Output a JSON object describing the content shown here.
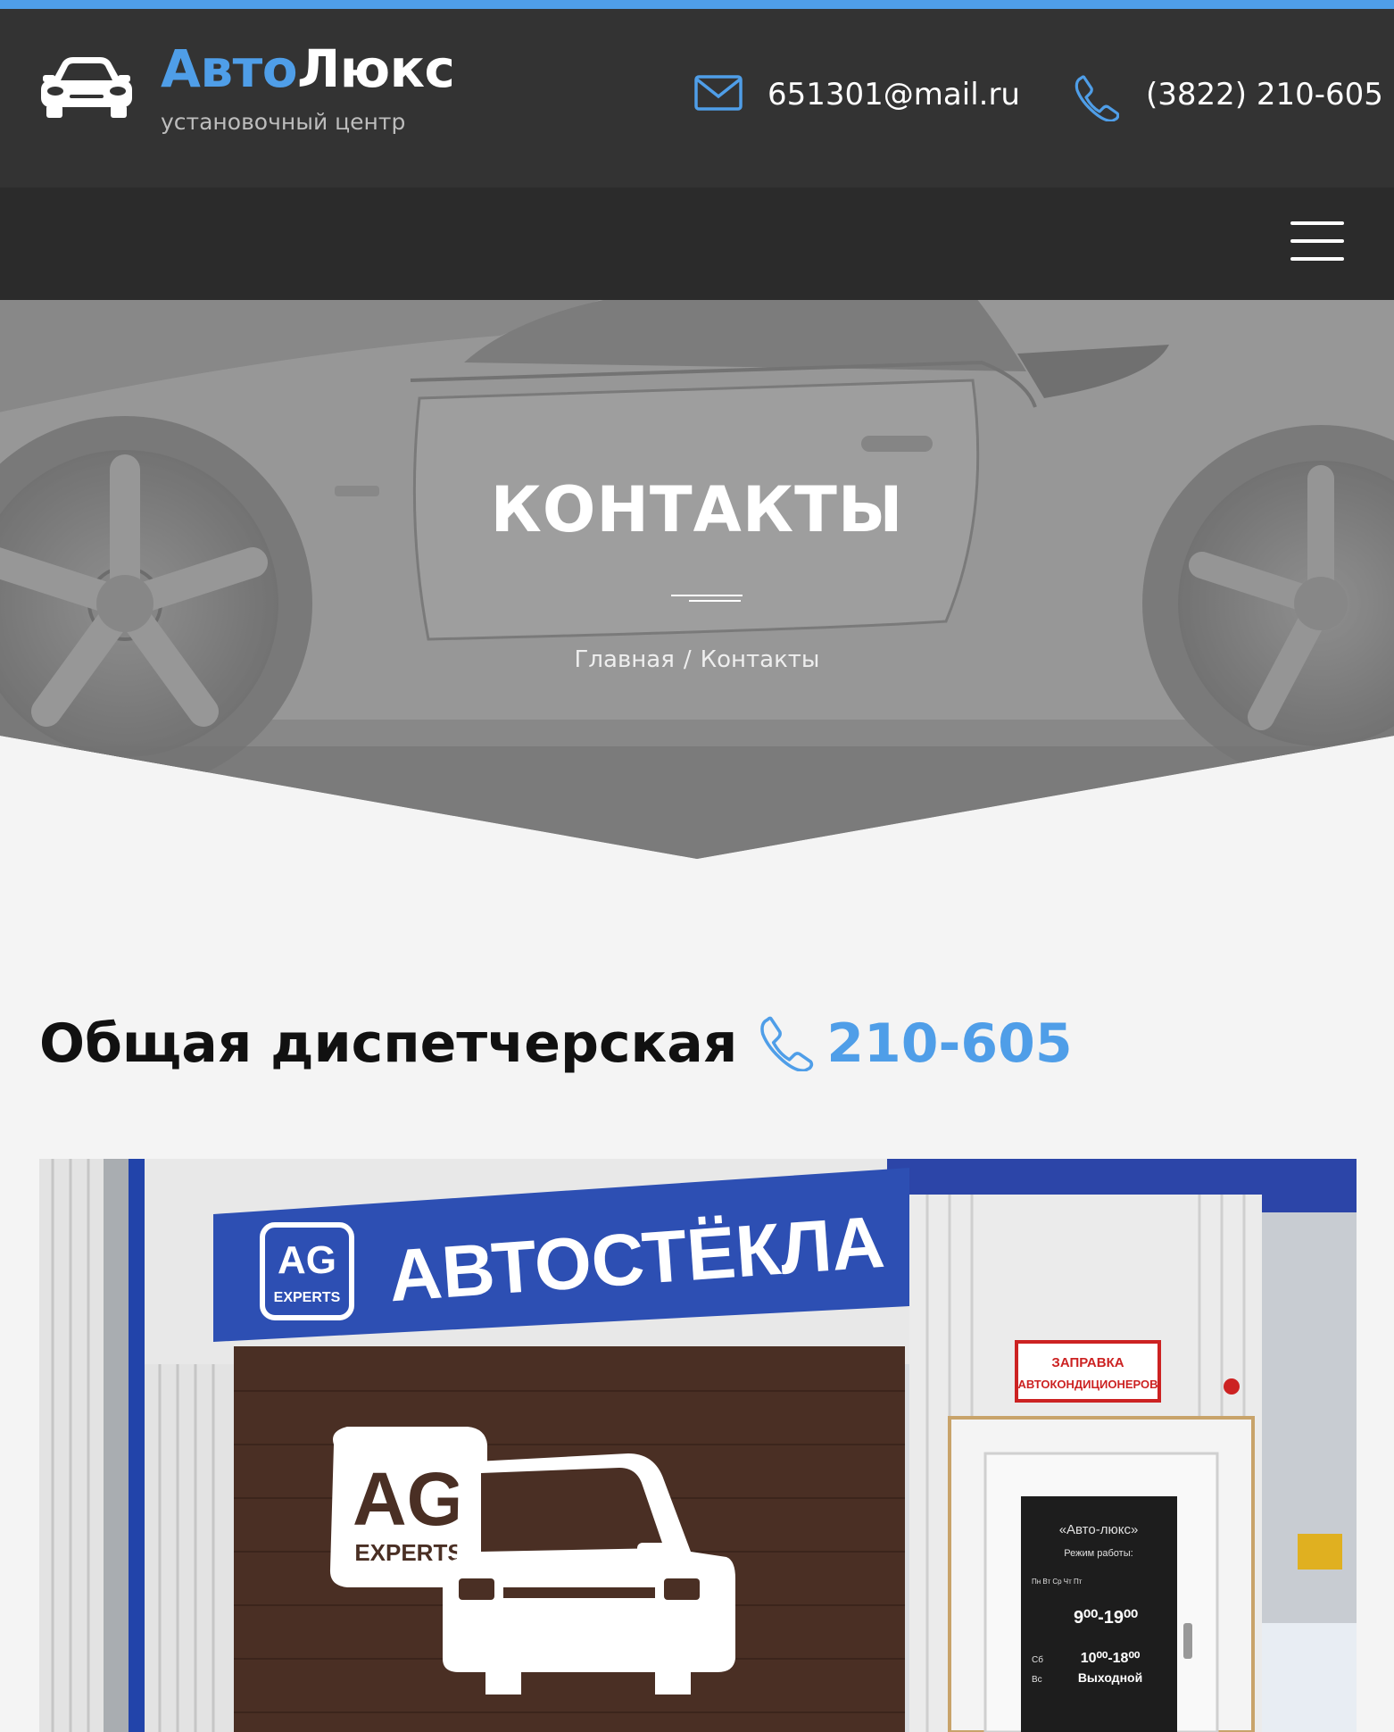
{
  "header": {
    "brand_part1": "Авто",
    "brand_part2": "Люкс",
    "tagline": "установочный центр",
    "email": "651301@mail.ru",
    "phone": "(3822) 210-605"
  },
  "hero": {
    "title": "КОНТАКТЫ",
    "breadcrumb": {
      "home": "Главная",
      "separator": "/",
      "current": "Контакты"
    }
  },
  "dispatch": {
    "label": "Общая диспетчерская",
    "number": "210-605"
  },
  "photo": {
    "sign_logo_top": "AG",
    "sign_logo_bottom": "EXPERTS",
    "sign_text": "АВТОСТЁКЛА",
    "red_sign_line1": "ЗАПРАВКА",
    "red_sign_line2": "АВТОКОНДИЦИОНЕРОВ",
    "door_title": "«Авто-люкс»",
    "door_hours_label": "Режим работы:",
    "door_days_weekday": "Пн Вт Ср Чт Пт",
    "door_weekday_hours": "9⁰⁰-19⁰⁰",
    "door_sat_label": "Сб",
    "door_sat_hours": "10⁰⁰-18⁰⁰",
    "door_sun_label": "Вс",
    "door_sun_hours": "Выходной"
  },
  "colors": {
    "accent": "#4f9ee8",
    "header_bg": "#333333",
    "nav_bg": "#2b2b2b",
    "page_bg": "#f4f4f4"
  },
  "icons": {
    "logo": "car-front-icon",
    "email": "envelope-icon",
    "phone": "phone-handset-icon",
    "menu": "hamburger-menu-icon"
  }
}
